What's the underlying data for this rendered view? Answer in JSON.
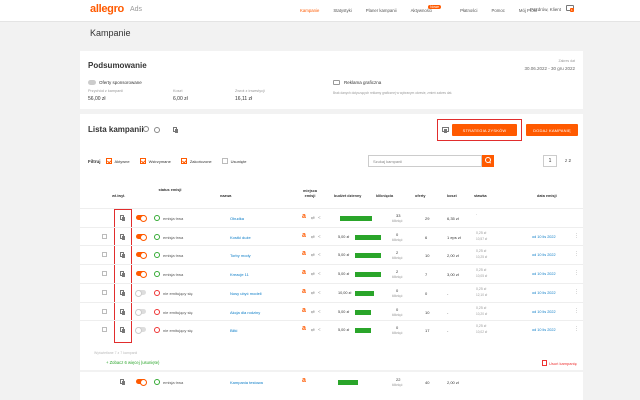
{
  "header": {
    "logo": "allegro",
    "logo_sub": "Ads",
    "nav": [
      {
        "label": "Kampanie",
        "active": true
      },
      {
        "label": "Statystyki"
      },
      {
        "label": "Planer kampanii"
      },
      {
        "label": "Aktywności",
        "badge": "Nowe"
      },
      {
        "label": "Płatności"
      },
      {
        "label": "Pomoc"
      },
      {
        "label": "Mój Profil"
      }
    ],
    "user": "Pozdrów, Klient",
    "user_badge": "1"
  },
  "page_title": "Kampanie",
  "summary": {
    "title": "Podsumowanie",
    "date_label": "Zakres dat",
    "date_value": "30.06.2022 - 30 gru 2022",
    "sponsored_label": "Oferty sponsorowane",
    "graphic_label": "Reklama graficzna",
    "metric1_label": "Przychód z kampanii",
    "metric1_value": "56,00 zł",
    "metric2_label": "Koszt",
    "metric2_value": "6,00 zł",
    "metric3_label": "Zwrot z inwestycji",
    "metric3_value": "16,11 zł",
    "graphic_note": "Brak danych dotyczących reklamy graficznej w wybranym okresie, zmień zakres dat."
  },
  "campaigns": {
    "title": "Lista kampanii",
    "btn_strategy": "STRATEGIA ZYSKÓW",
    "btn_add": "DODAJ KAMPANIĘ",
    "filters_label": "Filtruj",
    "filters": [
      {
        "label": "Aktywne",
        "checked": true
      },
      {
        "label": "Wstrzymane",
        "checked": true
      },
      {
        "label": "Zakończone",
        "checked": true
      },
      {
        "label": "Usunięte",
        "checked": false
      }
    ],
    "search_placeholder": "Szukaj kampanii",
    "page": "1",
    "page_total": "z 2",
    "columns": {
      "toggle": "wł./wył.",
      "status": "status emisji",
      "name": "nazwa",
      "placement": "miejsca emisji",
      "budget": "budżet dzienny",
      "clicks": "kliknięcia",
      "offers": "oferty",
      "cost": "koszt",
      "rate": "stawka",
      "end": "data emisji"
    },
    "rows": [
      {
        "on": true,
        "status": "emisja trwa",
        "name": "Obudka",
        "budget": "",
        "bar": 1.0,
        "clicks": "33",
        "clicks_sub": "kliknięć",
        "offers": "29",
        "cost": "6,35 zł",
        "rate": "-",
        "rate_sub": "",
        "end": ""
      },
      {
        "on": true,
        "status": "emisja trwa",
        "name": "Kostki duże",
        "budget": "5,00 zł",
        "bar": 0.8,
        "clicks": "0",
        "clicks_sub": "kliknięć",
        "offers": "6",
        "cost": "1 eps zł",
        "rate": "0,25 zł",
        "rate_sub": "10,57 zł",
        "end": "od 10 lis 2022"
      },
      {
        "on": true,
        "status": "emisja trwa",
        "name": "Torby mody",
        "budget": "5,00 zł",
        "bar": 0.8,
        "clicks": "2",
        "clicks_sub": "kliknięć",
        "offers": "10",
        "cost": "2,00 zł",
        "rate": "0,25 zł",
        "rate_sub": "10,25 zł",
        "end": "od 10 lis 2022"
      },
      {
        "on": true,
        "status": "emisja trwa",
        "name": "Kreacje 11",
        "budget": "5,00 zł",
        "bar": 0.8,
        "clicks": "2",
        "clicks_sub": "kliknięć",
        "offers": "7",
        "cost": "3,00 zł",
        "rate": "0,25 zł",
        "rate_sub": "10,05 zł",
        "end": "od 10 lis 2022"
      },
      {
        "on": false,
        "status": "nie emitujący się",
        "name": "Nosy ubyć modeli",
        "budget": "10,00 zł",
        "bar": 0.6,
        "clicks": "0",
        "clicks_sub": "kliknięć",
        "offers": "0",
        "cost": "-",
        "rate": "0,25 zł",
        "rate_sub": "12,10 zł",
        "end": "od 10 lis 2022"
      },
      {
        "on": false,
        "status": "nie emitujący się",
        "name": "Akcja dla rodziny",
        "budget": "5,00 zł",
        "bar": 0.5,
        "clicks": "0",
        "clicks_sub": "kliknięć",
        "offers": "10",
        "cost": "-",
        "rate": "0,25 zł",
        "rate_sub": "10,20 zł",
        "end": "od 10 lis 2022"
      },
      {
        "on": false,
        "status": "nie emitujący się",
        "name": "Biłki",
        "budget": "5,00 zł",
        "bar": 0.5,
        "clicks": "0",
        "clicks_sub": "kliknięć",
        "offers": "17",
        "cost": "-",
        "rate": "0,25 zł",
        "rate_sub": "10,02 zł",
        "end": "od 10 lis 2022"
      }
    ],
    "footer_note": "Wyświetlane 7 z 7 kampanii",
    "show_more": "+ Zobacz 6 więcej (usunięte)",
    "delete": "Usuń kampanię"
  },
  "next_row": {
    "status": "emisja trwa",
    "name": "Kampania testowa",
    "clicks": "22",
    "clicks_sub": "kliknięć",
    "offers": "40",
    "cost": "2,00 zł"
  }
}
